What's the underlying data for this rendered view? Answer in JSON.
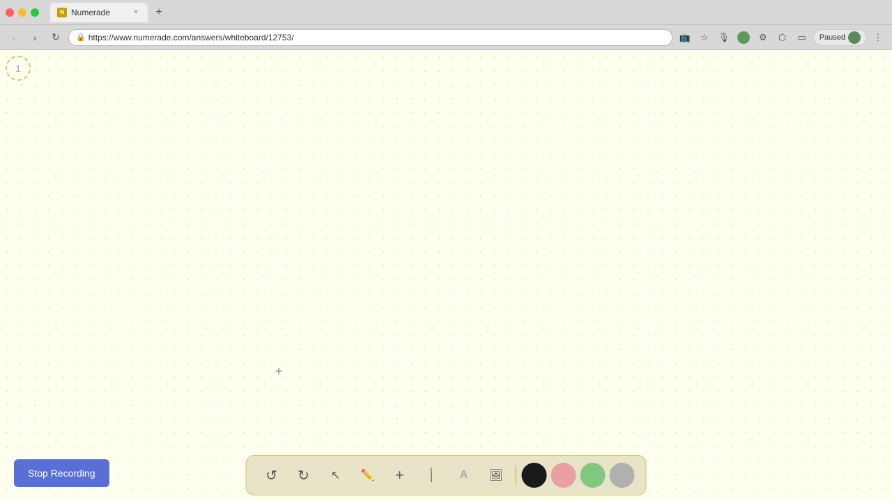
{
  "browser": {
    "tab": {
      "favicon_text": "N",
      "label": "Numerade",
      "close_label": "×"
    },
    "new_tab_label": "+",
    "address": {
      "url": "https://www.numerade.com/answers/whiteboard/12753/",
      "lock_icon": "🔒"
    },
    "nav": {
      "back": "‹",
      "forward": "›",
      "reload": "↻"
    },
    "toolbar": {
      "cast_icon": "📺",
      "bookmark_icon": "☆",
      "mic_icon": "🎙",
      "profile_icon": "●",
      "extension1_icon": "⚙",
      "extension2_icon": "⬡",
      "menu_icon": "⋮",
      "paused_label": "Paused"
    }
  },
  "whiteboard": {
    "page_number": "1",
    "cursor_symbol": "+",
    "background_color": "#fffff0"
  },
  "stop_recording": {
    "label": "Stop Recording"
  },
  "toolbar": {
    "undo_label": "↺",
    "redo_label": "↻",
    "cursor_label": "↖",
    "pen_label": "✏",
    "add_label": "+",
    "eraser_label": "/",
    "text_label": "A",
    "image_label": "🖼",
    "colors": [
      "#1a1a1a",
      "#e8a0a0",
      "#80c880",
      "#b0b0b0"
    ]
  }
}
